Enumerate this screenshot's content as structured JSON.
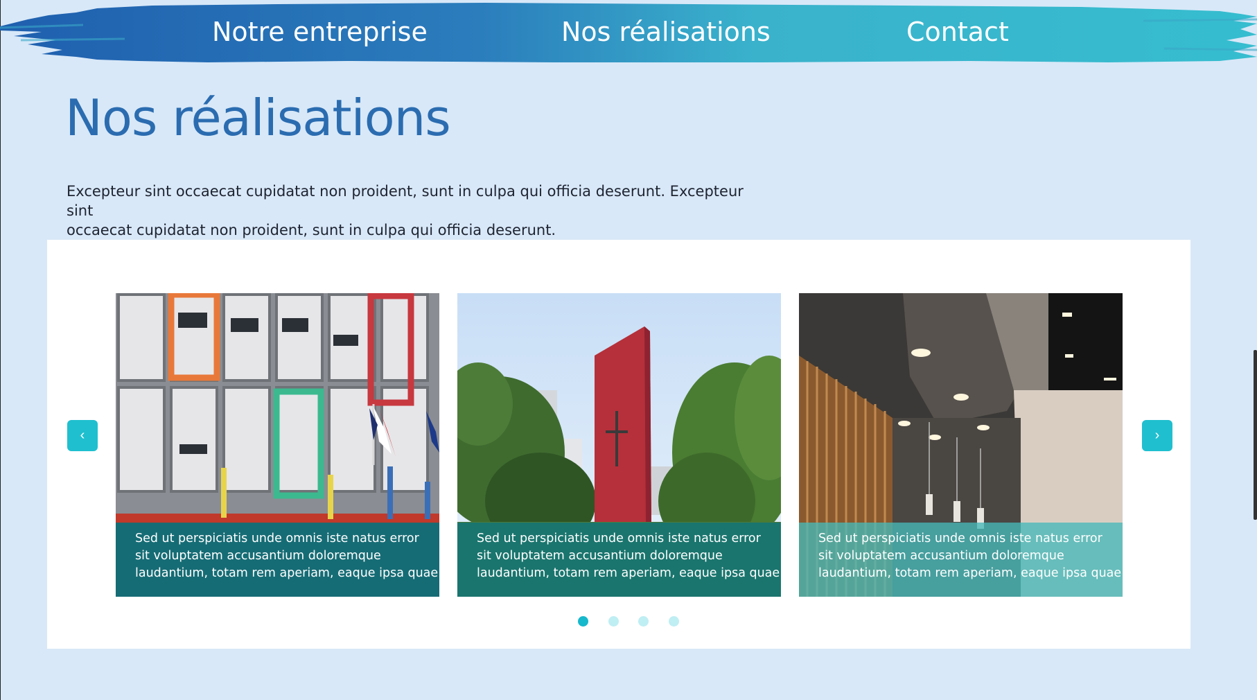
{
  "nav": {
    "items": [
      {
        "label": "Notre entreprise"
      },
      {
        "label": "Nos réalisations"
      },
      {
        "label": "Contact"
      }
    ],
    "brush_gradient": [
      "#2471b6",
      "#2f86bd",
      "#3fb6cc",
      "#38bccd"
    ]
  },
  "page": {
    "title": "Nos réalisations",
    "intro_line1": "Excepteur sint occaecat cupidatat non proident, sunt in culpa qui officia deserunt. Excepteur sint",
    "intro_line2": "occaecat cupidatat non proident, sunt in culpa qui officia deserunt."
  },
  "carousel": {
    "prev_icon": "‹",
    "next_icon": "›",
    "cards": [
      {
        "image": "colorful-building-facade-photo",
        "caption_line1": "Sed ut perspiciatis unde omnis iste natus error",
        "caption_line2": "sit voluptatem accusantium doloremque",
        "caption_line3": "laudantium, totam rem aperiam, eaque ipsa quae"
      },
      {
        "image": "red-monument-trees-photo",
        "caption_line1": "Sed ut perspiciatis unde omnis iste natus error",
        "caption_line2": "sit voluptatem accusantium doloremque",
        "caption_line3": "laudantium, totam rem aperiam, eaque ipsa quae"
      },
      {
        "image": "interior-hall-lights-photo",
        "caption_line1": "Sed ut perspiciatis unde omnis iste natus error",
        "caption_line2": "sit voluptatem accusantium doloremque",
        "caption_line3": "laudantium, totam rem aperiam, eaque ipsa quae"
      }
    ],
    "slide_count": 4,
    "active_slide": 1
  },
  "colors": {
    "background": "#d8e8f8",
    "title": "#2b6cb0",
    "accent": "#1fbfcf"
  }
}
